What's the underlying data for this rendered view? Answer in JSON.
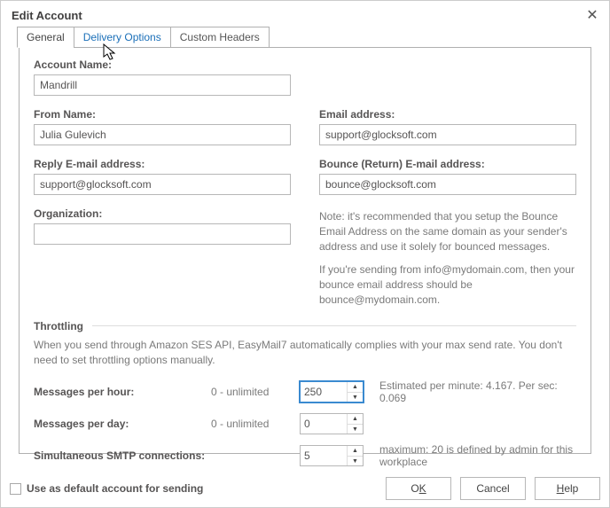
{
  "dialog": {
    "title": "Edit Account"
  },
  "tabs": {
    "general": "General",
    "delivery": "Delivery Options",
    "custom": "Custom Headers"
  },
  "labels": {
    "accountName": "Account Name:",
    "fromName": "From Name:",
    "emailAddress": "Email address:",
    "replyEmail": "Reply E-mail address:",
    "bounceEmail": "Bounce (Return) E-mail address:",
    "organization": "Organization:",
    "throttling": "Throttling",
    "msgPerHour": "Messages per hour:",
    "msgPerDay": "Messages per day:",
    "smtpConn": "Simultaneous SMTP connections:",
    "unlimited": "0 - unlimited"
  },
  "values": {
    "accountName": "Mandrill",
    "fromName": "Julia Gulevich",
    "emailAddress": "support@glocksoft.com",
    "replyEmail": "support@glocksoft.com",
    "bounceEmail": "bounce@glocksoft.com",
    "organization": "",
    "msgPerHour": "250",
    "msgPerDay": "0",
    "smtpConn": "5"
  },
  "notes": {
    "bounce1": "Note: it's recommended that you setup the Bounce Email Address on the same domain as your sender's address and use it solely for bounced messages.",
    "bounce2": "If you're sending from info@mydomain.com, then your bounce email address should be bounce@mydomain.com.",
    "throttlingDesc": "When you send through Amazon SES API, EasyMail7 automatically complies with your max send rate. You don't need to set throttling options manually.",
    "perHourEst": "Estimated per minute: 4.167. Per sec: 0.069",
    "smtpMax": "maximum: 20 is defined by admin for this workplace"
  },
  "footer": {
    "defaultChk": "Use as default account for sending",
    "ok_pre": "O",
    "ok_und": "K",
    "cancel": "Cancel",
    "help_und": "H",
    "help_post": "elp"
  }
}
